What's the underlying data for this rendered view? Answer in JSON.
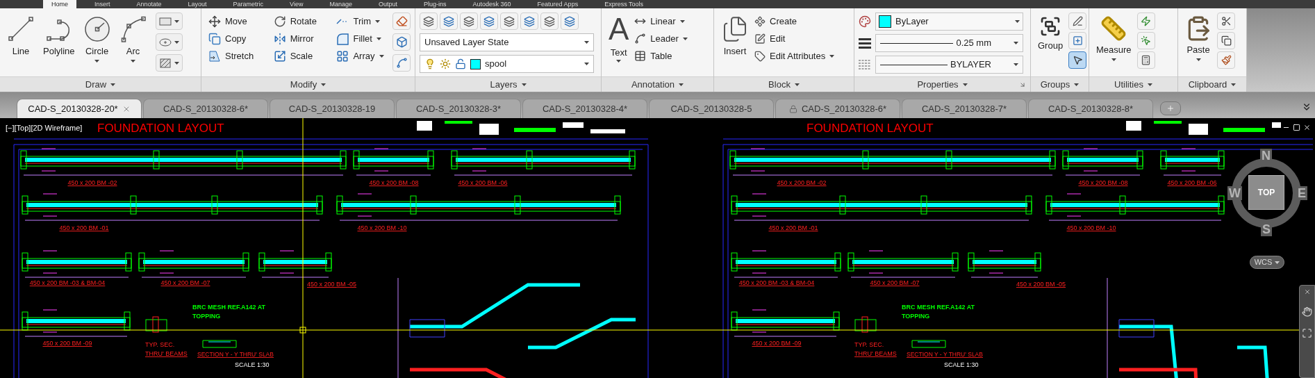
{
  "menu_tabs": [
    {
      "label": "Home",
      "selected": true
    },
    {
      "label": "Insert",
      "selected": false
    },
    {
      "label": "Annotate",
      "selected": false
    },
    {
      "label": "Layout",
      "selected": false
    },
    {
      "label": "Parametric",
      "selected": false
    },
    {
      "label": "View",
      "selected": false
    },
    {
      "label": "Manage",
      "selected": false
    },
    {
      "label": "Output",
      "selected": false
    },
    {
      "label": "Plug-ins",
      "selected": false
    },
    {
      "label": "Autodesk 360",
      "selected": false
    },
    {
      "label": "Featured Apps",
      "selected": false
    },
    {
      "label": "Express Tools",
      "selected": false
    }
  ],
  "draw_panel": {
    "title": "Draw",
    "tools": [
      {
        "label": "Line",
        "has_menu": false
      },
      {
        "label": "Polyline",
        "has_menu": false
      },
      {
        "label": "Circle",
        "has_menu": true
      },
      {
        "label": "Arc",
        "has_menu": true
      }
    ]
  },
  "modify_panel": {
    "title": "Modify",
    "tools": [
      {
        "label": "Move",
        "has_menu": false
      },
      {
        "label": "Copy",
        "has_menu": false
      },
      {
        "label": "Stretch",
        "has_menu": false
      },
      {
        "label": "Rotate",
        "has_menu": false
      },
      {
        "label": "Mirror",
        "has_menu": false
      },
      {
        "label": "Scale",
        "has_menu": false
      },
      {
        "label": "Trim",
        "has_menu": true
      },
      {
        "label": "Fillet",
        "has_menu": true
      },
      {
        "label": "Array",
        "has_menu": true
      }
    ]
  },
  "layers_panel": {
    "title": "Layers",
    "layer_state": "Unsaved Layer State",
    "current_layer": {
      "name": "spool",
      "color": "#00ffff"
    }
  },
  "annotation_panel": {
    "title": "Annotation",
    "big_tool": {
      "glyph": "A",
      "label": "Text",
      "has_menu": true
    },
    "tools": [
      {
        "label": "Linear",
        "has_menu": true
      },
      {
        "label": "Leader",
        "has_menu": true
      },
      {
        "label": "Table",
        "has_menu": false
      }
    ]
  },
  "block_panel": {
    "title": "Block",
    "big_tool": {
      "label": "Insert",
      "has_menu": false
    },
    "tools": [
      {
        "label": "Create",
        "has_menu": false
      },
      {
        "label": "Edit",
        "has_menu": false
      },
      {
        "label": "Edit Attributes",
        "has_menu": true
      }
    ]
  },
  "properties_panel": {
    "title": "Properties",
    "color": {
      "label": "ByLayer",
      "color": "#00ffff"
    },
    "lineweight": "0.25 mm",
    "linetype": "BYLAYER"
  },
  "groups_panel": {
    "title": "Groups",
    "big_tool": {
      "label": "Group",
      "has_menu": false
    },
    "group_selection_on": true
  },
  "utilities_panel": {
    "title": "Utilities",
    "big_tool": {
      "label": "Measure",
      "has_menu": true
    }
  },
  "clipboard_panel": {
    "title": "Clipboard",
    "big_tool": {
      "label": "Paste",
      "has_menu": true
    }
  },
  "file_tabs": [
    {
      "label": "CAD-S_20130328-20*",
      "selected": true,
      "locked": false
    },
    {
      "label": "CAD-S_20130328-6*",
      "selected": false,
      "locked": false
    },
    {
      "label": "CAD-S_20130328-19",
      "selected": false,
      "locked": false
    },
    {
      "label": "CAD-S_20130328-3*",
      "selected": false,
      "locked": false
    },
    {
      "label": "CAD-S_20130328-4*",
      "selected": false,
      "locked": false
    },
    {
      "label": "CAD-S_20130328-5",
      "selected": false,
      "locked": false
    },
    {
      "label": "CAD-S_20130328-6*",
      "selected": false,
      "locked": true
    },
    {
      "label": "CAD-S_20130328-7*",
      "selected": false,
      "locked": false
    },
    {
      "label": "CAD-S_20130328-8*",
      "selected": false,
      "locked": false
    }
  ],
  "viewport": {
    "label": "[−][Top][2D Wireframe]"
  },
  "drawing": {
    "sheets": [
      {
        "title": "FOUNDATION LAYOUT",
        "beam_labels": [
          "450 x 200 BM -02",
          "450 x 200 BM -08",
          "450 x 200 BM -06",
          "450 x 200 BM -01",
          "450 x 200 BM -10",
          "450 x 200 BM -03 & BM-04",
          "450 x 200 BM -07",
          "450 x 200 BM -05",
          "450 x 200 BM -09"
        ],
        "mesh_note": [
          "BRC MESH REF.A142 AT",
          "TOPPING"
        ],
        "typical_section": [
          "TYP. SEC.",
          "THRU' BEAMS"
        ],
        "section_title": "SECTION Y - Y THRU' SLAB",
        "scale": "SCALE 1:30"
      },
      {
        "title": "FOUNDATION LAYOUT",
        "beam_labels": [
          "450 x 200 BM -02",
          "450 x 200 BM -08",
          "450 x 200 BM -06",
          "450 x 200 BM -01",
          "450 x 200 BM -10",
          "450 x 200 BM -03 & BM-04",
          "450 x 200 BM -07",
          "450 x 200 BM -05",
          "450 x 200 BM -09"
        ],
        "mesh_note": [
          "BRC MESH REF.A142 AT",
          "TOPPING"
        ],
        "typical_section": [
          "TYP. SEC.",
          "THRU' BEAMS"
        ],
        "section_title": "SECTION Y - Y THRU' SLAB",
        "scale": "SCALE 1:30"
      }
    ]
  },
  "viewcube": {
    "north": "N",
    "south": "S",
    "east": "E",
    "west": "W",
    "face": "TOP",
    "ucs": "WCS"
  }
}
